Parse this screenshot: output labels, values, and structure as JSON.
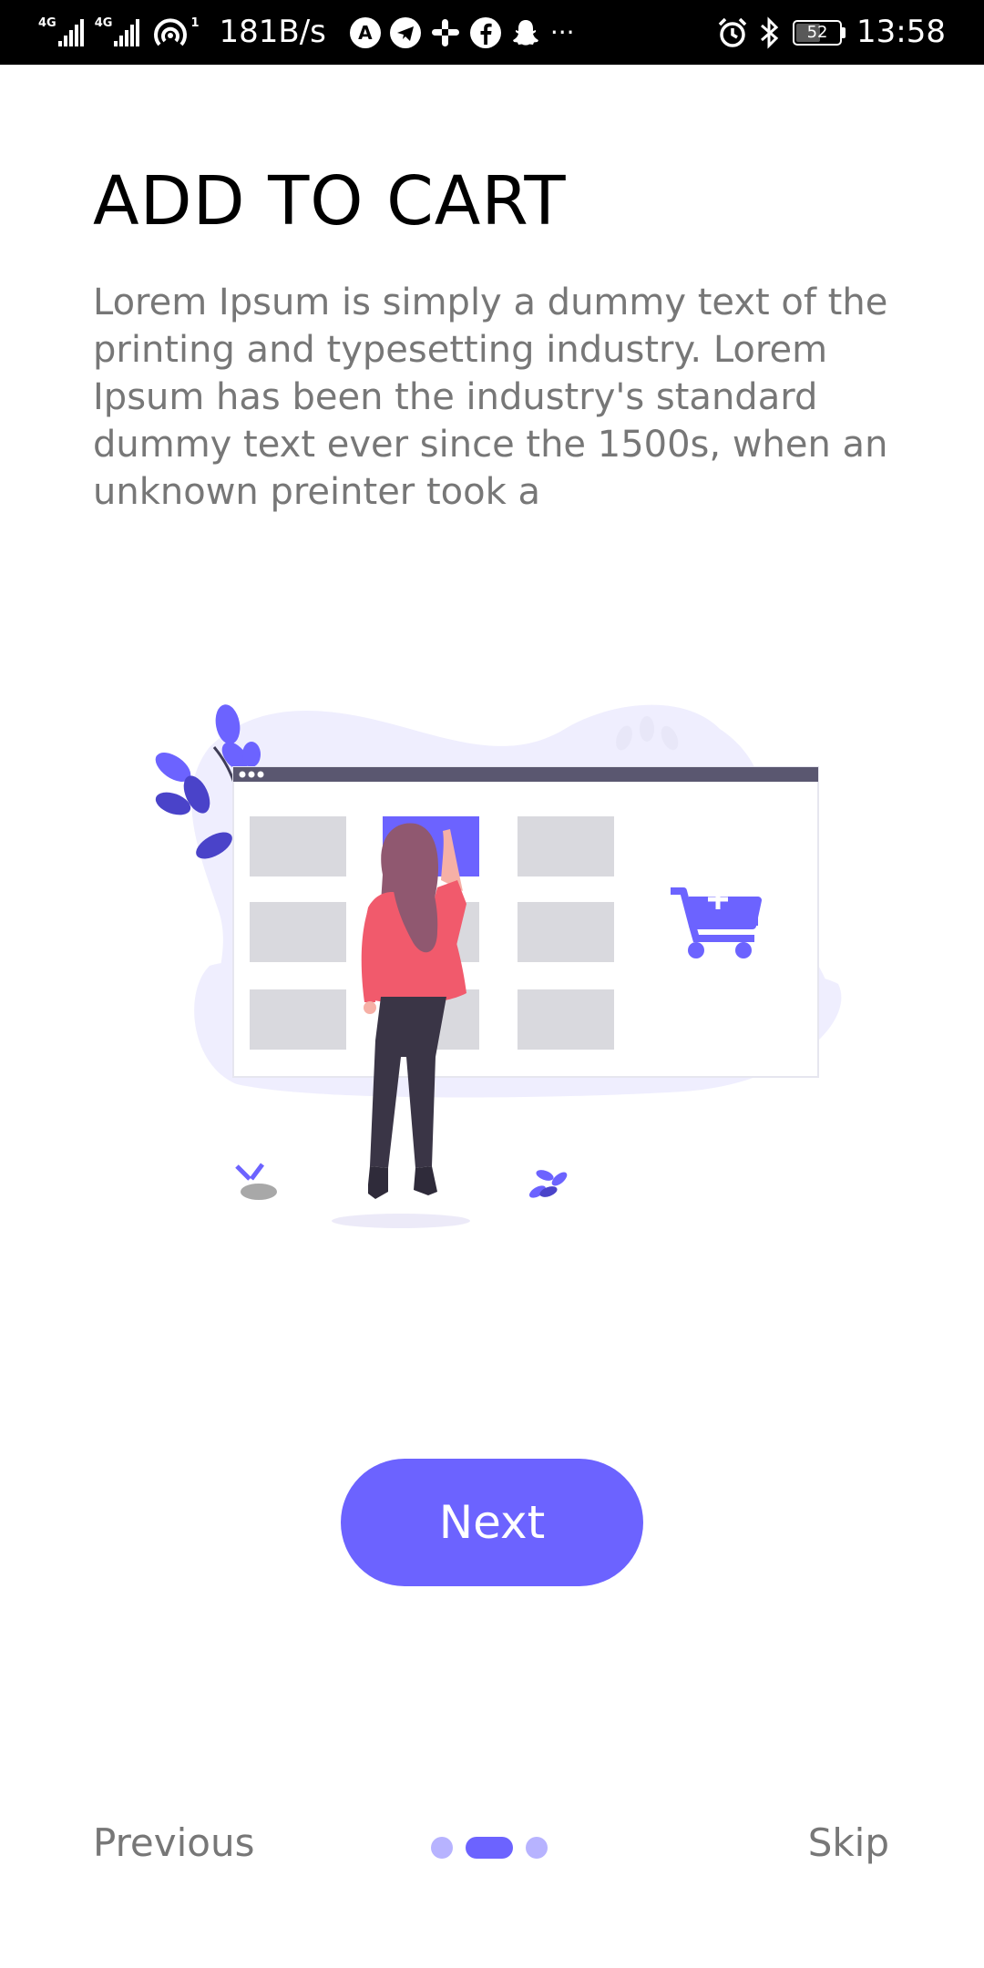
{
  "status_bar": {
    "network_1": "4G",
    "network_2": "4G",
    "hotspot_count": "1",
    "speed": "181B/s",
    "more_icon": "···",
    "battery": "52",
    "time": "13:58"
  },
  "onboarding": {
    "title": "ADD TO CART",
    "description": "Lorem Ipsum is simply a dummy text of the printing and typesetting industry. Lorem Ipsum has been the industry's standard dummy text ever since the 1500s, when an unknown preinter took a",
    "illustration_icon": "add-to-cart-illustration",
    "next_label": "Next",
    "previous_label": "Previous",
    "skip_label": "Skip",
    "page_index": 2,
    "page_count": 3
  },
  "colors": {
    "accent": "#6c63ff",
    "accent_light": "#b7b3ff",
    "text_muted": "#777777",
    "tile_gray": "#d9d9de",
    "browser_bar": "#5a5770",
    "skin": "#f6b0a6",
    "hair": "#905870",
    "jacket": "#f15a6c",
    "pants": "#3a3546"
  }
}
